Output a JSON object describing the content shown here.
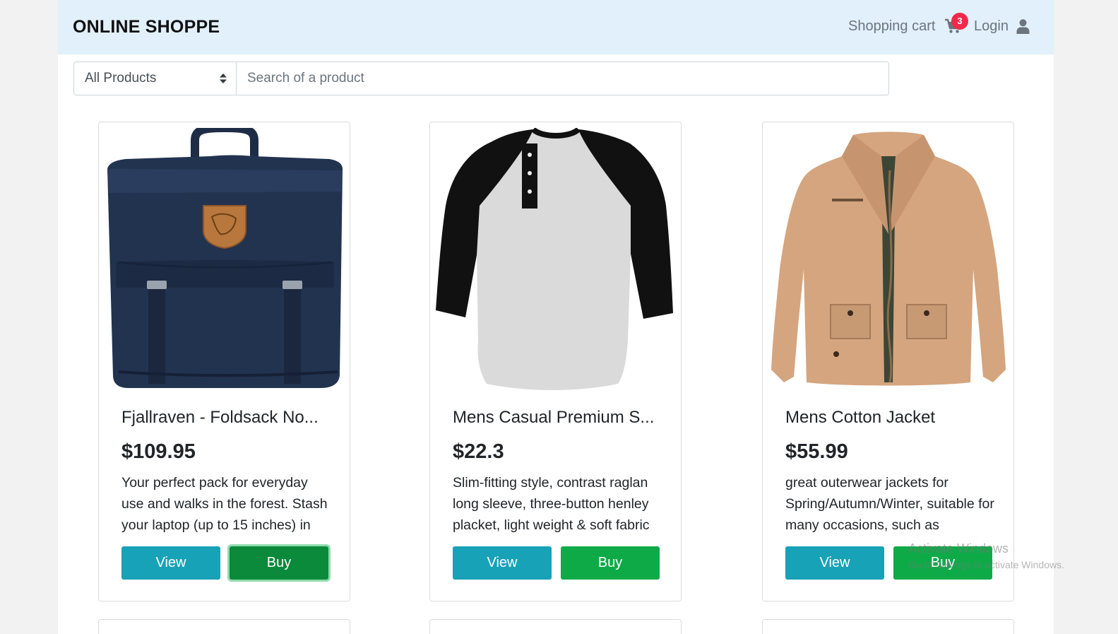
{
  "navbar": {
    "brand": "ONLINE SHOPPE",
    "cart_label": "Shopping cart",
    "cart_count": "3",
    "login_label": "Login"
  },
  "filter": {
    "category_selected": "All Products",
    "search_placeholder": "Search of a product",
    "search_value": ""
  },
  "products": [
    {
      "title": "Fjallraven - Foldsack No...",
      "price": "$109.95",
      "description": "Your perfect pack for everyday use and walks in the forest. Stash your laptop (up to 15 inches) in",
      "view_label": "View",
      "buy_label": "Buy",
      "image": "navy-backpack"
    },
    {
      "title": "Mens Casual Premium S...",
      "price": "$22.3",
      "description": "Slim-fitting style, contrast raglan long sleeve, three-button henley placket, light weight & soft fabric",
      "view_label": "View",
      "buy_label": "Buy",
      "image": "raglan-henley-shirt"
    },
    {
      "title": "Mens Cotton Jacket",
      "price": "$55.99",
      "description": "great outerwear jackets for Spring/Autumn/Winter, suitable for many occasions, such as",
      "view_label": "View",
      "buy_label": "Buy",
      "image": "tan-cotton-jacket"
    }
  ],
  "watermark": {
    "line1": "Activate Windows",
    "line2": "Go to Settings to activate Windows."
  },
  "colors": {
    "navbar_bg": "#e1f0fb",
    "view_button": "#17a2b8",
    "buy_button": "#0eaa48",
    "badge": "#f0294a"
  }
}
